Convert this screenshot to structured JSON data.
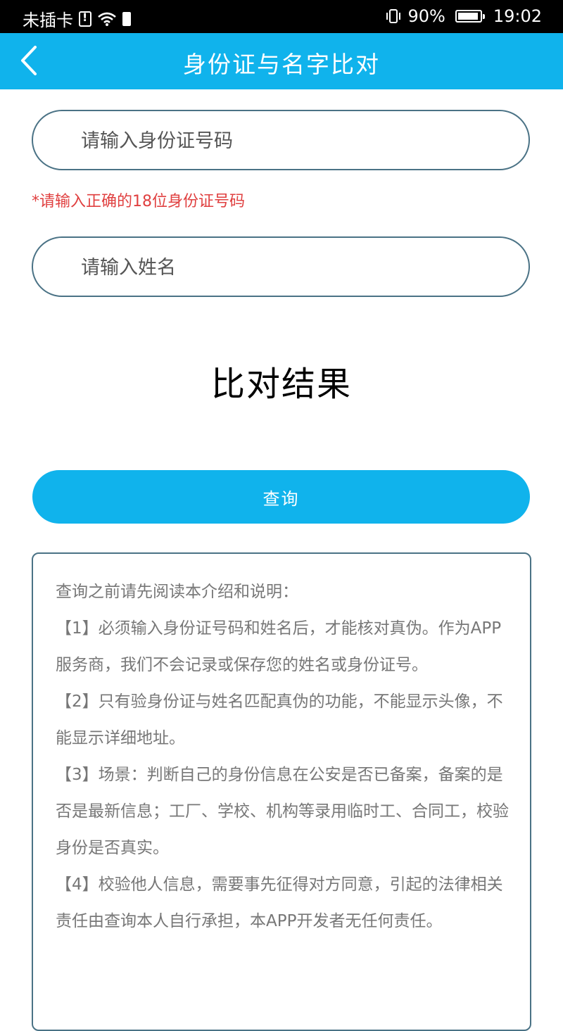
{
  "status_bar": {
    "carrier": "未插卡",
    "battery_percent": "90%",
    "time": "19:02"
  },
  "header": {
    "title": "身份证与名字比对"
  },
  "form": {
    "id_placeholder": "请输入身份证号码",
    "id_error": "*请输入正确的18位身份证号码",
    "name_placeholder": "请输入姓名"
  },
  "result": {
    "title": "比对结果"
  },
  "query_button": {
    "label": "查询"
  },
  "info": {
    "intro": "查询之前请先阅读本介绍和说明：",
    "items": [
      "【1】必须输入身份证号码和姓名后，才能核对真伪。作为APP服务商，我们不会记录或保存您的姓名或身份证号。",
      "【2】只有验身份证与姓名匹配真伪的功能，不能显示头像，不能显示详细地址。",
      "【3】场景：判断自己的身份信息在公安是否已备案，备案的是否是最新信息；工厂、学校、机构等录用临时工、合同工，校验身份是否真实。",
      "【4】校验他人信息，需要事先征得对方同意，引起的法律相关责任由查询本人自行承担，本APP开发者无任何责任。"
    ]
  },
  "colors": {
    "accent": "#10b3ec",
    "border": "#4a7285",
    "error": "#e04040"
  }
}
